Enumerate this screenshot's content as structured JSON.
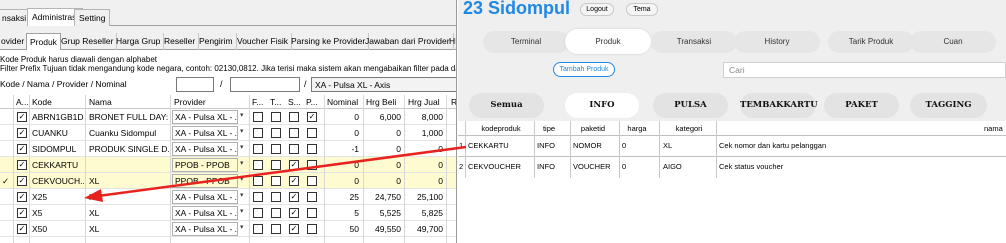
{
  "desktop": {
    "main_tabs": [
      "nsaksi",
      "Administrasi",
      "Setting"
    ],
    "sub_tabs": [
      "ovider",
      "Produk",
      "Grup Reseller",
      "Harga Grup",
      "Reseller",
      "Pengirim",
      "Voucher Fisik",
      "Parsing ke Provider",
      "Jawaban dari Provider",
      "HI"
    ],
    "info_line1": "Kode Produk harus diawali dengan alphabet",
    "info_line2": "Filter Prefix Tujuan tidak mengandung kode negara, contoh: 02130,0812. Jika terisi maka sistem akan mengabaikan filter pada data provi",
    "filter_label": "Kode / Nama / Provider / Nominal",
    "filter_slash1": "/",
    "filter_slash2": "/",
    "filter_provider": "XA - Pulsa XL - Axis",
    "columns": [
      "A...",
      "Kode",
      "Nama",
      "Provider",
      "F...",
      "T...",
      "S...",
      "P...",
      "Nominal",
      "Hrg Beli",
      "Hrg Jual",
      "R"
    ],
    "rows": [
      {
        "kode": "ABRN1GB1D",
        "nama": "BRONET FULL DAY:...",
        "provider": "XA - Pulsa XL - ...",
        "checks": [
          false,
          false,
          false,
          true
        ],
        "nominal": "0",
        "beli": "6,000",
        "jual": "8,000",
        "highlight": false,
        "marker": ""
      },
      {
        "kode": "CUANKU",
        "nama": "Cuanku Sidompul",
        "provider": "XA - Pulsa XL - ...",
        "checks": [
          false,
          false,
          false,
          false
        ],
        "nominal": "0",
        "beli": "0",
        "jual": "1,000",
        "highlight": false,
        "marker": ""
      },
      {
        "kode": "SIDOMPUL",
        "nama": "PRODUK SINGLE D...",
        "provider": "XA - Pulsa XL - ...",
        "checks": [
          false,
          false,
          false,
          false
        ],
        "nominal": "-1",
        "beli": "0",
        "jual": "0",
        "highlight": false,
        "marker": ""
      },
      {
        "kode": "CEKKARTU",
        "nama": "",
        "provider": "PPOB - PPOB",
        "checks": [
          false,
          false,
          true,
          false
        ],
        "nominal": "0",
        "beli": "0",
        "jual": "0",
        "highlight": true,
        "marker": ""
      },
      {
        "kode": "CEKVOUCH...",
        "nama": "XL",
        "provider": "PPOB - PPOB",
        "checks": [
          false,
          false,
          true,
          false
        ],
        "nominal": "0",
        "beli": "0",
        "jual": "0",
        "highlight": true,
        "marker": "✓"
      },
      {
        "kode": "X25",
        "nama": "XL",
        "provider": "XA - Pulsa XL - ...",
        "checks": [
          false,
          false,
          true,
          false
        ],
        "nominal": "25",
        "beli": "24,750",
        "jual": "25,100",
        "highlight": false,
        "marker": ""
      },
      {
        "kode": "X5",
        "nama": "XL",
        "provider": "XA - Pulsa XL - ...",
        "checks": [
          false,
          false,
          true,
          false
        ],
        "nominal": "5",
        "beli": "5,525",
        "jual": "5,825",
        "highlight": false,
        "marker": ""
      },
      {
        "kode": "X50",
        "nama": "XL",
        "provider": "XA - Pulsa XL - ...",
        "checks": [
          false,
          false,
          true,
          false
        ],
        "nominal": "50",
        "beli": "49,550",
        "jual": "49,700",
        "highlight": false,
        "marker": ""
      }
    ]
  },
  "web": {
    "title": "23 Sidompul",
    "logout": "Logout",
    "tema": "Tema",
    "nav": [
      "Terminal",
      "Produk",
      "Transaksi",
      "History",
      "Tarik Produk",
      "Cuan"
    ],
    "add_button": "Tambah Produk",
    "search_placeholder": "Cari",
    "categories": [
      "Semua",
      "INFO",
      "PULSA",
      "TEMBAKKARTU",
      "PAKET",
      "TAGGING"
    ],
    "table_headers": [
      "kodeproduk",
      "tipe",
      "paketid",
      "harga",
      "kategori",
      "nama"
    ],
    "table_rows": [
      {
        "no": "1",
        "kode": "CEKKARTU",
        "tipe": "INFO",
        "paketid": "NOMOR",
        "harga": "0",
        "kategori": "XL",
        "nama": "Cek nomor dan kartu pelanggan"
      },
      {
        "no": "2",
        "kode": "CEKVOUCHER",
        "tipe": "INFO",
        "paketid": "VOUCHER",
        "harga": "0",
        "kategori": "AIGO",
        "nama": "Cek status voucher"
      }
    ],
    "arrow_color": "#e8231f",
    "accent": "#1e88e5"
  }
}
